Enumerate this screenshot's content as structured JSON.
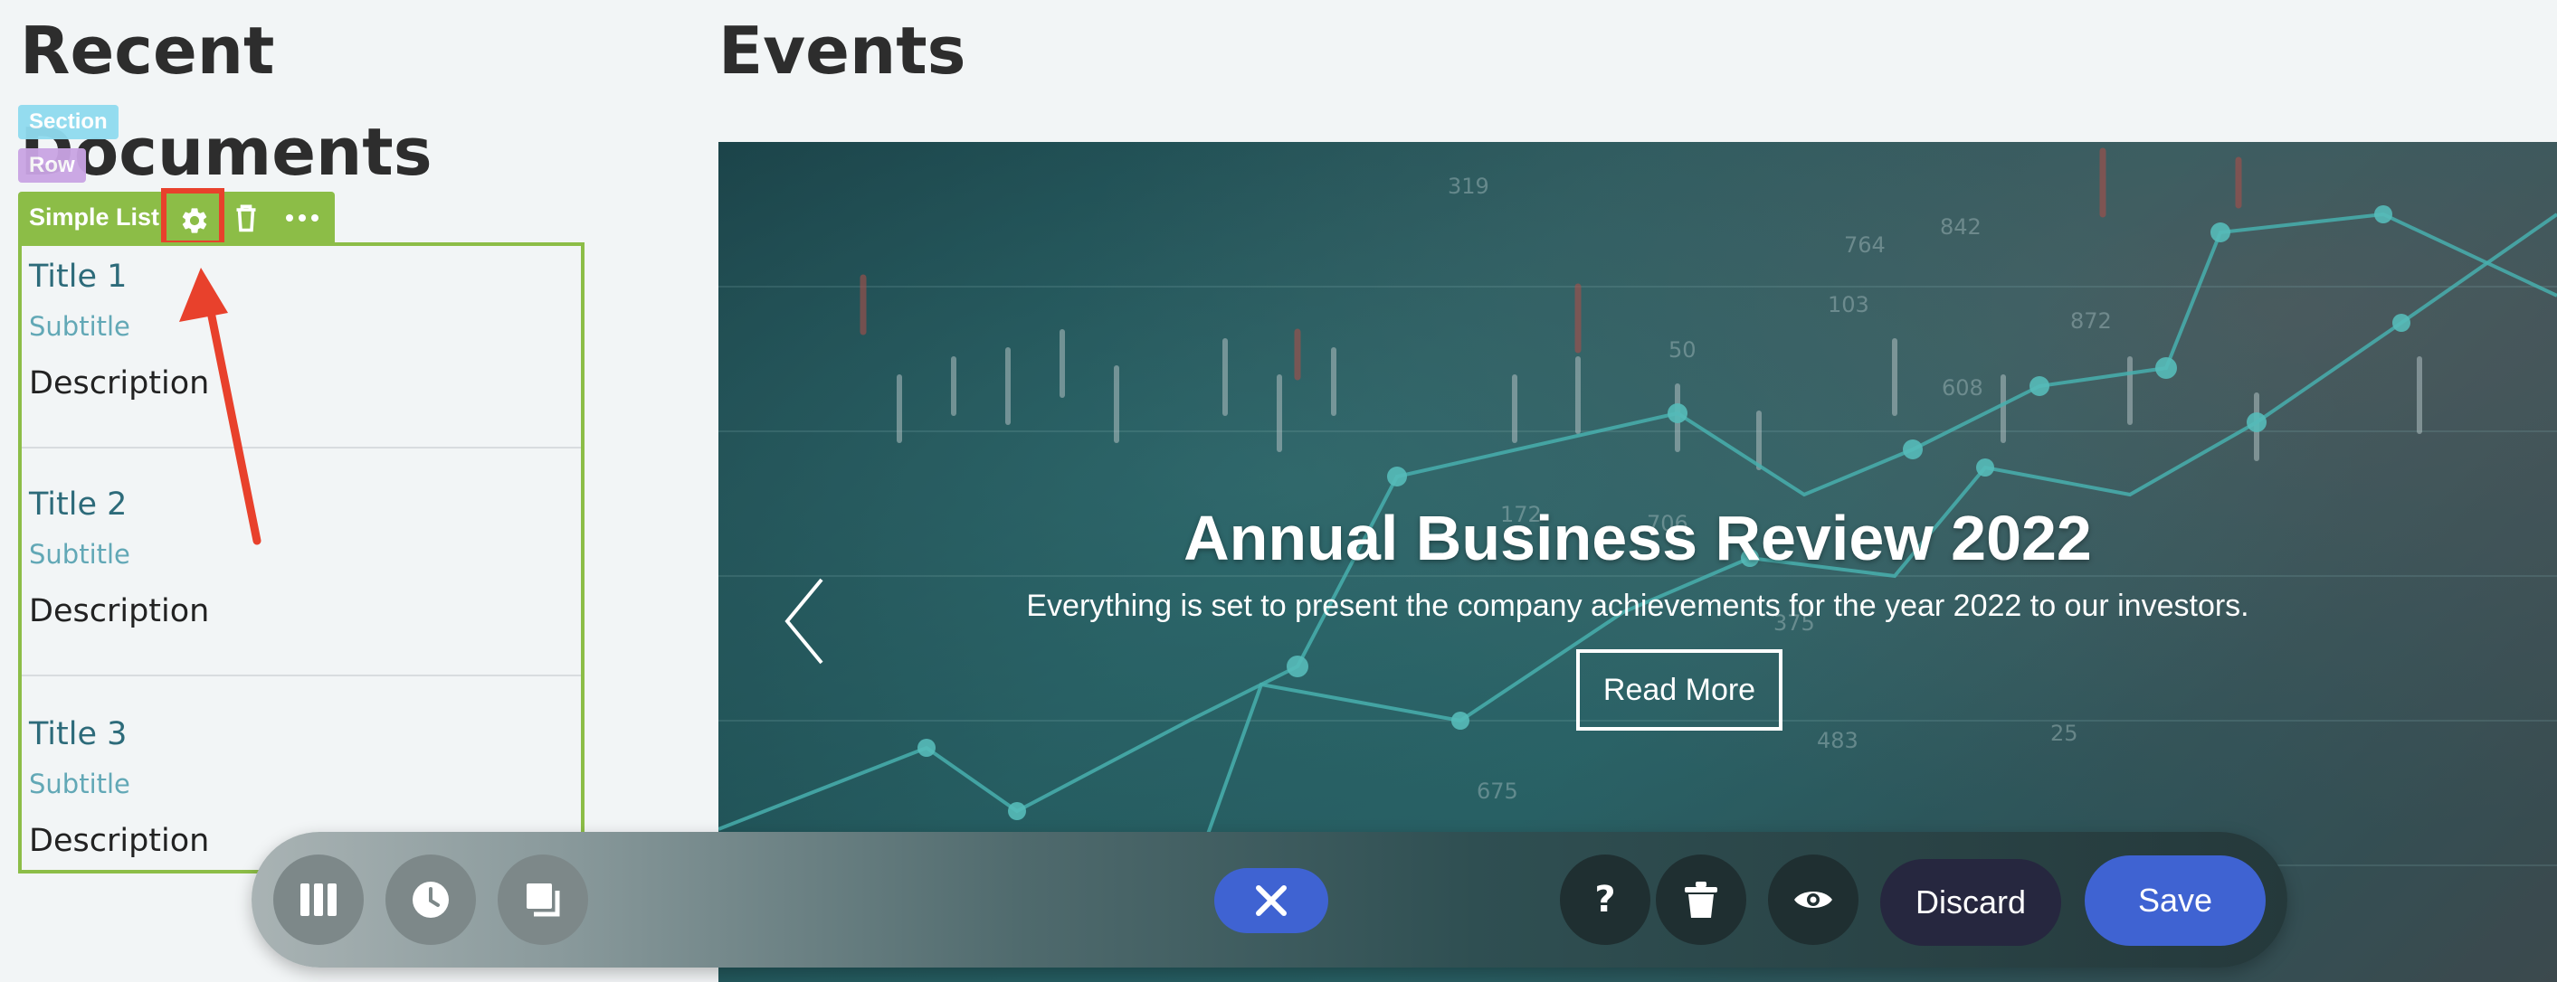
{
  "left_column": {
    "heading": "Recent Documents"
  },
  "right_column": {
    "heading": "Events"
  },
  "editor_badges": {
    "section": "Section",
    "row": "Row"
  },
  "module": {
    "label": "Simple List",
    "items": [
      {
        "title": "Title 1",
        "subtitle": "Subtitle",
        "description": "Description"
      },
      {
        "title": "Title 2",
        "subtitle": "Subtitle",
        "description": "Description"
      },
      {
        "title": "Title 3",
        "subtitle": "Subtitle",
        "description": "Description"
      }
    ],
    "toolbar_icons": [
      "gear-icon",
      "trash-icon",
      "more-icon"
    ]
  },
  "hero": {
    "title": "Annual Business Review 2022",
    "subtitle": "Everything is set to present the company achievements for the year 2022 to our investors.",
    "button_label": "Read More",
    "chart_numbers": [
      "319",
      "842",
      "764",
      "103",
      "872",
      "608",
      "706",
      "375",
      "483",
      "675",
      "25",
      "50",
      "172"
    ]
  },
  "editor_bar": {
    "left_icons": [
      "columns-icon",
      "history-icon",
      "layers-icon"
    ],
    "center_icon": "close-icon",
    "right_icons": [
      "help-icon",
      "trash-icon",
      "preview-eye-icon"
    ],
    "discard_label": "Discard",
    "save_label": "Save"
  },
  "colors": {
    "module_green": "#8cbd47",
    "annotation_red": "#e8412c",
    "primary_blue": "#3f63d2",
    "discard_navy": "#26273f",
    "section_badge": "#8fdbef",
    "row_badge": "#c9a4e4"
  }
}
